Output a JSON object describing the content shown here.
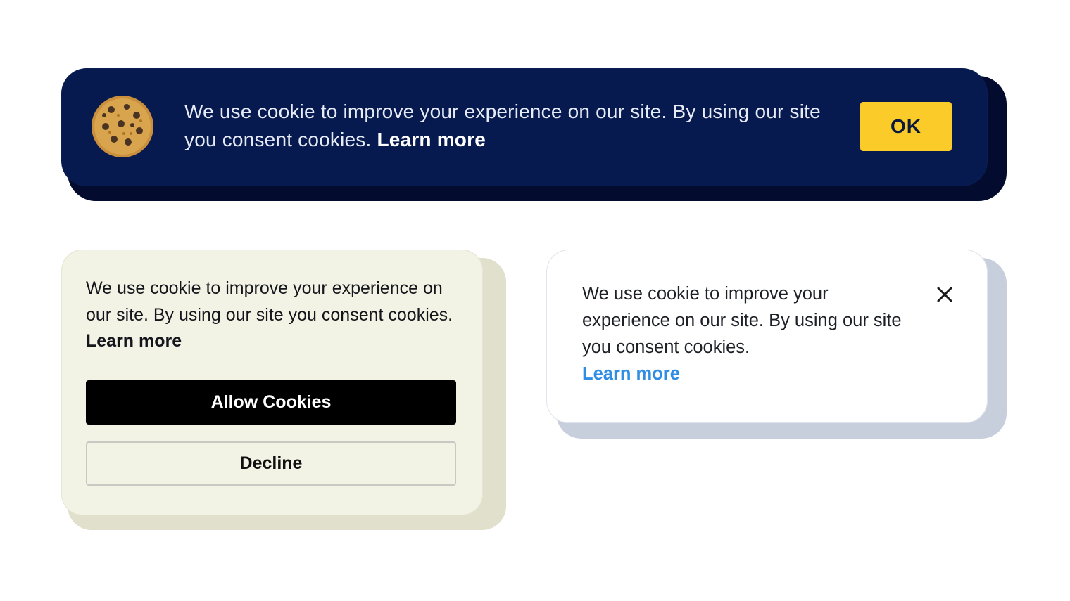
{
  "colors": {
    "background": "#ffffff",
    "dark_banner": "#061a4f",
    "ok_button": "#fbcb2a",
    "beige_card": "#f2f2e5",
    "allow_button": "#000000",
    "link_blue": "#2f8de4"
  },
  "banner_dark": {
    "icon": "cookie-icon",
    "message": "We use cookie to improve your experience on our site. By using our site you consent cookies.",
    "learn_more": "Learn more",
    "ok_label": "OK"
  },
  "card_beige": {
    "message": "We use cookie to improve your experience on our site. By using our site you consent cookies.",
    "learn_more": "Learn more",
    "allow_label": "Allow Cookies",
    "decline_label": "Decline"
  },
  "card_white": {
    "message": "We use cookie to improve your experience on our site. By using our site you consent cookies.",
    "learn_more": "Learn more",
    "close_icon": "close-icon"
  }
}
